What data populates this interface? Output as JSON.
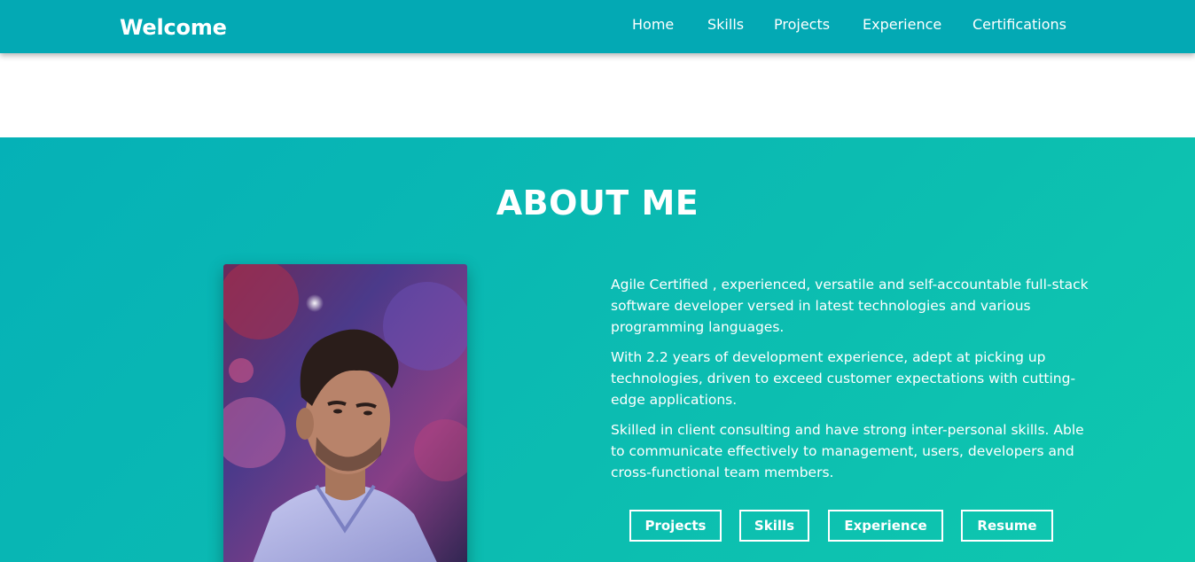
{
  "navbar": {
    "brand": "Welcome",
    "links": [
      {
        "label": "Home"
      },
      {
        "label": "Skills"
      },
      {
        "label": "Projects"
      },
      {
        "label": "Experience"
      },
      {
        "label": "Certifications"
      }
    ],
    "background_color": "#03a9b4"
  },
  "about": {
    "title": "ABOUT ME",
    "paragraphs": [
      "Agile Certified , experienced, versatile and self-accountable full-stack software developer versed in latest technologies and various programming languages.",
      "With 2.2 years of development experience, adept at picking up technologies, driven to exceed customer expectations with cutting-edge applications.",
      "Skilled in client consulting and have strong inter-personal skills. Able to communicate effectively to management, users, developers and cross-functional team members."
    ],
    "buttons": [
      {
        "label": "Projects"
      },
      {
        "label": "Skills"
      },
      {
        "label": "Experience"
      },
      {
        "label": "Resume"
      }
    ],
    "gradient_colors": [
      "#05b1b7",
      "#0ec8ae"
    ]
  }
}
